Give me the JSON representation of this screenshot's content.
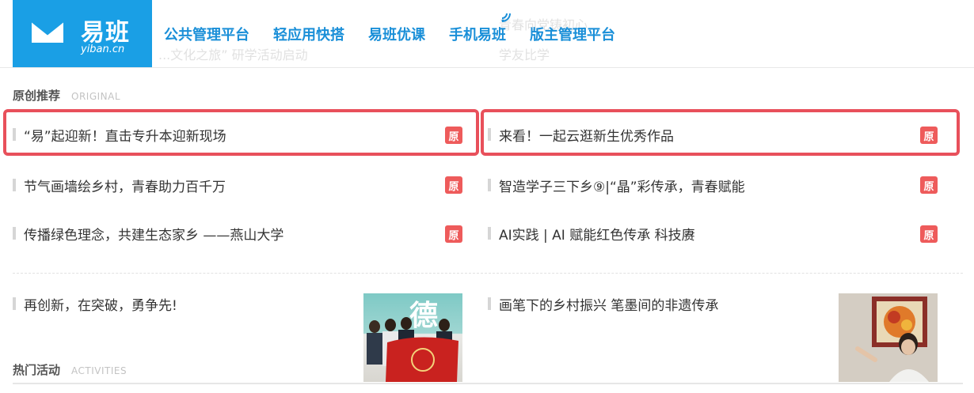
{
  "header": {
    "logo_text": "易班",
    "logo_sub": "yiban.cn",
    "nav": [
      "公共管理平台",
      "轻应用快搭",
      "易班优课",
      "手机易班",
      "版主管理平台"
    ],
    "ghost_lines": [
      "青春向党铸初心",
      "...文化之旅” 研学活动启动",
      "学友比学"
    ]
  },
  "original": {
    "title": "原创推荐",
    "title_en": "ORIGINAL",
    "badge": "原",
    "items": [
      "“易”起迎新！直击专升本迎新现场",
      "来看！一起云逛新生优秀作品",
      "节气画墙绘乡村，青春助力百千万",
      "智造学子三下乡⑨|“晶”彩传承，青春赋能",
      "传播绿色理念，共建生态家乡 ——燕山大学",
      "AI实践 | AI 赋能红色传承 科技赓"
    ]
  },
  "features": [
    "再创新，在突破，勇争先!",
    "画笔下的乡村振兴 笔墨间的非遗传承"
  ],
  "thumb1_text": "德",
  "activities": {
    "title": "热门活动",
    "title_en": "ACTIVITIES"
  },
  "colors": {
    "brand_blue": "#1a9fe5",
    "nav_blue": "#1a8fd8",
    "badge_red": "#ee5b5b",
    "highlight_red": "#e8505b"
  }
}
